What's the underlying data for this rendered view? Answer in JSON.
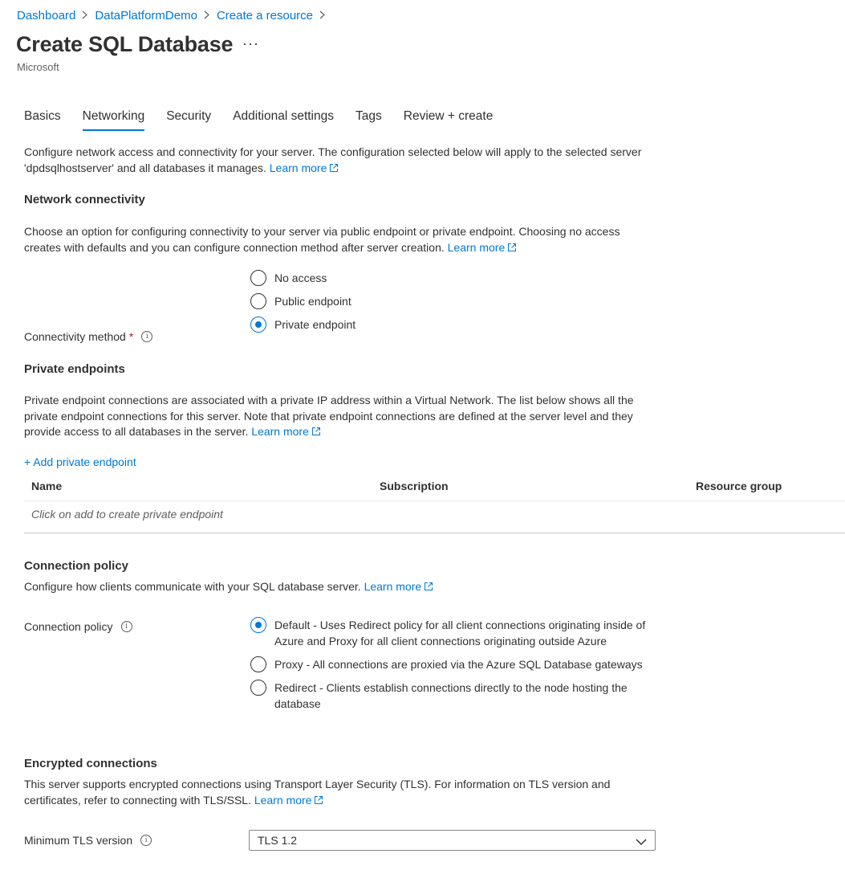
{
  "breadcrumb": [
    "Dashboard",
    "DataPlatformDemo",
    "Create a resource"
  ],
  "page": {
    "title": "Create SQL Database",
    "more_label": "···",
    "publisher": "Microsoft"
  },
  "tabs": [
    "Basics",
    "Networking",
    "Security",
    "Additional settings",
    "Tags",
    "Review + create"
  ],
  "active_tab": "Networking",
  "intro": {
    "text": "Configure network access and connectivity for your server. The configuration selected below will apply to the selected server 'dpdsqlhostserver' and all databases it manages.",
    "link": "Learn more"
  },
  "network_connectivity": {
    "heading": "Network connectivity",
    "text": "Choose an option for configuring connectivity to your server via public endpoint or private endpoint. Choosing no access creates with defaults and you can configure connection method after server creation.",
    "link": "Learn more",
    "field_label": "Connectivity method",
    "required_mark": "*",
    "options": [
      "No access",
      "Public endpoint",
      "Private endpoint"
    ],
    "selected": "Private endpoint"
  },
  "private_endpoints": {
    "heading": "Private endpoints",
    "text": "Private endpoint connections are associated with a private IP address within a Virtual Network. The list below shows all the private endpoint connections for this server. Note that private endpoint connections are defined at the server level and they provide access to all databases in the server.",
    "link": "Learn more",
    "add_label": "+ Add private endpoint",
    "columns": [
      "Name",
      "Subscription",
      "Resource group"
    ],
    "empty_text": "Click on add to create private endpoint"
  },
  "connection_policy": {
    "heading": "Connection policy",
    "text": "Configure how clients communicate with your SQL database server.",
    "link": "Learn more",
    "field_label": "Connection policy",
    "options": [
      "Default - Uses Redirect policy for all client connections originating inside of Azure and Proxy for all client connections originating outside Azure",
      "Proxy - All connections are proxied via the Azure SQL Database gateways",
      "Redirect - Clients establish connections directly to the node hosting the database"
    ],
    "selected": "Default"
  },
  "encrypted_connections": {
    "heading": "Encrypted connections",
    "text": "This server supports encrypted connections using Transport Layer Security (TLS). For information on TLS version and certificates, refer to connecting with TLS/SSL.",
    "link": "Learn more",
    "field_label": "Minimum TLS version",
    "value": "TLS 1.2"
  },
  "colors": {
    "accent": "#0078d4",
    "text": "#323130",
    "required": "#a4262c"
  },
  "icons": {
    "separator": "chevron-right-icon",
    "external": "external-link-icon",
    "info": "info-icon",
    "dropdown": "chevron-down-icon"
  }
}
